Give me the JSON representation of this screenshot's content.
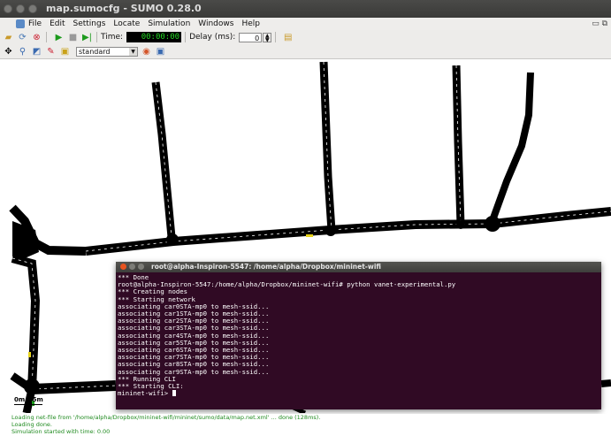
{
  "window": {
    "title": "map.sumocfg - SUMO 0.28.0"
  },
  "menu": {
    "items": [
      "File",
      "Edit",
      "Settings",
      "Locate",
      "Simulation",
      "Windows",
      "Help"
    ]
  },
  "toolbar": {
    "time_label": "Time:",
    "time_value": "00:00:00",
    "delay_label": "Delay (ms):",
    "delay_value": "0",
    "scheme_value": "standard"
  },
  "scale": {
    "left": "0m",
    "right": "5m"
  },
  "terminal": {
    "title": "root@alpha-Inspiron-5547: /home/alpha/Dropbox/mininet-wifi",
    "lines": [
      "*** Done",
      "root@alpha-Inspiron-5547:/home/alpha/Dropbox/mininet-wifi# python vanet-experimental.py",
      "*** Creating nodes",
      "*** Starting network",
      "associating car0STA-mp0 to mesh-ssid...",
      "associating car1STA-mp0 to mesh-ssid...",
      "associating car2STA-mp0 to mesh-ssid...",
      "associating car3STA-mp0 to mesh-ssid...",
      "associating car4STA-mp0 to mesh-ssid...",
      "associating car5STA-mp0 to mesh-ssid...",
      "associating car6STA-mp0 to mesh-ssid...",
      "associating car7STA-mp0 to mesh-ssid...",
      "associating car8STA-mp0 to mesh-ssid...",
      "associating car9STA-mp0 to mesh-ssid...",
      "*** Running CLI",
      "*** Starting CLI:"
    ],
    "prompt": "mininet-wifi> "
  },
  "status": {
    "lines": [
      "Loading net-file from '/home/alpha/Dropbox/mininet-wifi/mininet/sumo/data/map.net.xml' ... done (128ms).",
      "Loading done.",
      "Simulation started with time: 0.00"
    ]
  },
  "colors": {
    "terminal_bg": "#300a24",
    "status_text": "#1f8a1f",
    "time_digits": "#23d823"
  }
}
